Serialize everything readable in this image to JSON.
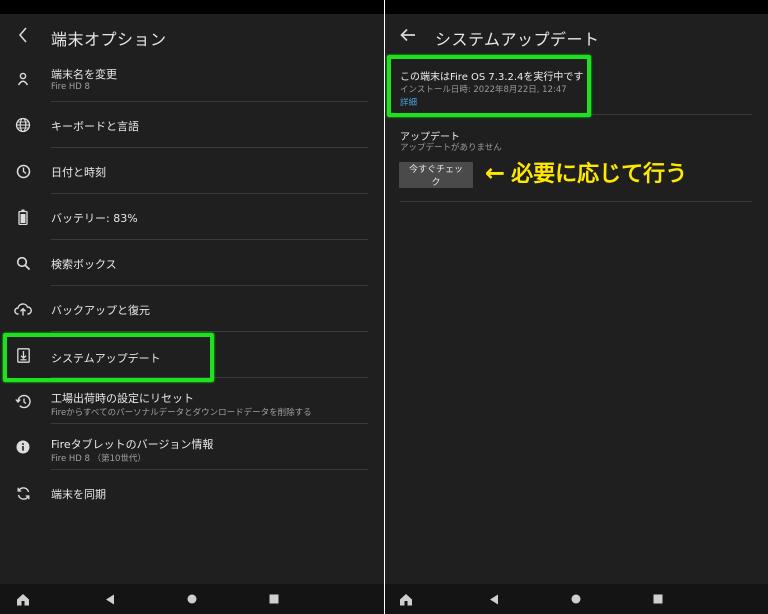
{
  "left": {
    "header": {
      "title": "端末オプション"
    },
    "items": [
      {
        "label": "端末名を変更",
        "sub": "Fire HD 8",
        "icon": "person-icon"
      },
      {
        "label": "キーボードと言語",
        "icon": "globe-icon"
      },
      {
        "label": "日付と時刻",
        "icon": "clock-icon"
      },
      {
        "label": "バッテリー: 83%",
        "icon": "battery-icon"
      },
      {
        "label": "検索ボックス",
        "icon": "search-icon"
      },
      {
        "label": "バックアップと復元",
        "icon": "cloud-upload-icon"
      },
      {
        "label": "システムアップデート",
        "icon": "download-box-icon"
      },
      {
        "label": "工場出荷時の設定にリセット",
        "sub": "Fireからすべてのパーソナルデータとダウンロードデータを削除する",
        "icon": "restore-icon"
      },
      {
        "label": "Fireタブレットのバージョン情報",
        "sub": "Fire HD 8 （第10世代）",
        "icon": "info-icon"
      },
      {
        "label": "端末を同期",
        "icon": "sync-icon"
      }
    ]
  },
  "right": {
    "header": {
      "title": "システムアップデート"
    },
    "os_line": "この端末はFire OS 7.3.2.4を実行中です",
    "install_line": "インストール日時: 2022年8月22日, 12:47",
    "details_link": "詳細",
    "update_title": "アップデート",
    "update_status": "アップデートがありません",
    "check_button": "今すぐチェック",
    "annotation": {
      "arrow": "←",
      "text": "必要に応じて行う"
    }
  },
  "navbar": {
    "icons": [
      "home-icon",
      "back-triangle-icon",
      "home-circle-icon",
      "recents-square-icon"
    ]
  },
  "colors": {
    "background": "#1f1f1f",
    "highlight": "#1fe01f",
    "annotation": "#ffe800",
    "link": "#4aa3df"
  }
}
